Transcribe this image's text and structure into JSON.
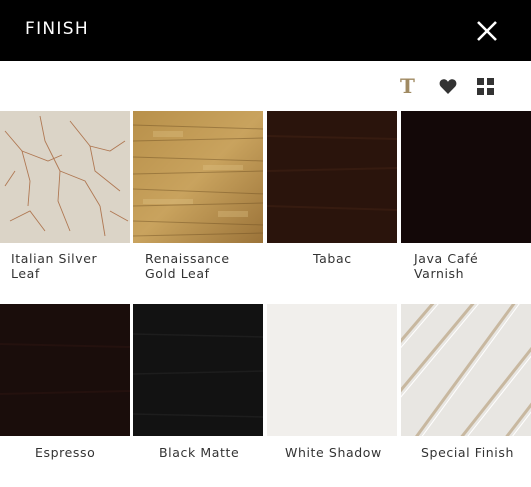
{
  "header": {
    "title": "FINISH"
  },
  "toolbar": {
    "text_toggle_glyph": "T"
  },
  "finishes": [
    {
      "label": "Italian Silver Leaf",
      "line1": "Italian Silver",
      "line2": "Leaf"
    },
    {
      "label": "Renaissance Gold Leaf",
      "line1": "Renaissance",
      "line2": "Gold Leaf"
    },
    {
      "label": "Tabac",
      "line1": "Tabac",
      "line2": ""
    },
    {
      "label": "Java Café Varnish",
      "line1": "Java Café",
      "line2": "Varnish"
    },
    {
      "label": "Espresso",
      "line1": "Espresso",
      "line2": ""
    },
    {
      "label": "Black Matte",
      "line1": "Black Matte",
      "line2": ""
    },
    {
      "label": "White Shadow",
      "line1": "White Shadow",
      "line2": ""
    },
    {
      "label": "Special Finish",
      "line1": "Special Finish",
      "line2": ""
    }
  ],
  "colors": {
    "header_bg": "#000000",
    "accent_gold": "#a08a62",
    "tabac": "#2a140c",
    "java": "#130808",
    "espresso": "#1a0d0b",
    "black_matte": "#121212",
    "white_shadow": "#f5f3f1"
  }
}
